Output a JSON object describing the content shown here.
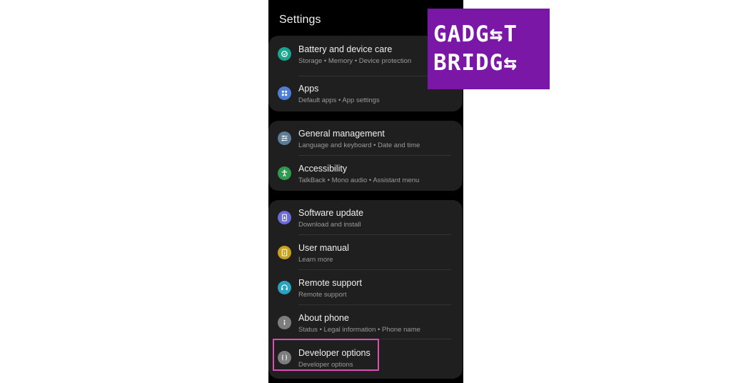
{
  "screen": {
    "title": "Settings"
  },
  "colors": {
    "battery": "#1aa58f",
    "apps": "#4e7ed8",
    "general": "#5f7c96",
    "accessibility": "#2f9a4f",
    "software_update": "#6b6bd6",
    "user_manual": "#c9a21d",
    "remote_support": "#2aa3bf",
    "about_phone": "#7d7d7d",
    "developer": "#7d7d7d",
    "highlight": "#e04bb5",
    "logo_bg": "#7b17a6"
  },
  "groups": [
    {
      "items": [
        {
          "title": "Battery and device care",
          "subtitle": "Storage  •  Memory  •  Device protection",
          "icon": "battery-care-icon"
        },
        {
          "title": "Apps",
          "subtitle": "Default apps  •  App settings",
          "icon": "apps-icon"
        }
      ]
    },
    {
      "items": [
        {
          "title": "General management",
          "subtitle": "Language and keyboard  •  Date and time",
          "icon": "sliders-icon"
        },
        {
          "title": "Accessibility",
          "subtitle": "TalkBack  •  Mono audio  •  Assistant menu",
          "icon": "accessibility-icon"
        }
      ]
    },
    {
      "items": [
        {
          "title": "Software update",
          "subtitle": "Download and install",
          "icon": "software-update-icon"
        },
        {
          "title": "User manual",
          "subtitle": "Learn more",
          "icon": "manual-icon"
        },
        {
          "title": "Remote support",
          "subtitle": "Remote support",
          "icon": "headset-icon"
        },
        {
          "title": "About phone",
          "subtitle": "Status  •  Legal information  •  Phone name",
          "icon": "info-icon"
        },
        {
          "title": "Developer options",
          "subtitle": "Developer options",
          "icon": "braces-icon"
        }
      ]
    }
  ],
  "logo": {
    "line1": "GADG⇆T",
    "line2": "BRIDG⇆"
  }
}
